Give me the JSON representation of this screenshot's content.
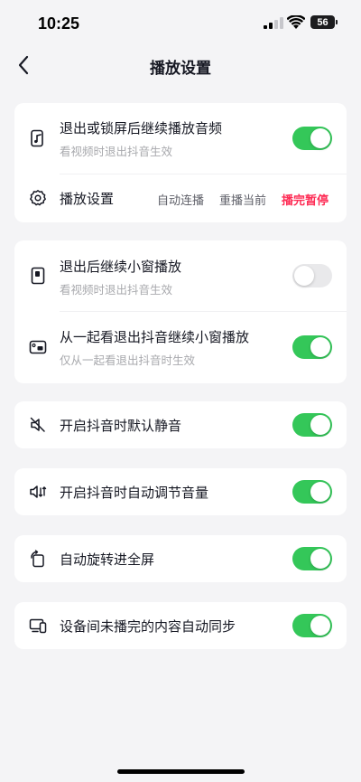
{
  "status": {
    "time": "10:25",
    "battery": "56"
  },
  "header": {
    "title": "播放设置"
  },
  "card1": {
    "background_play": {
      "title": "退出或锁屏后继续播放音频",
      "subtitle": "看视频时退出抖音生效",
      "enabled": true
    },
    "playback": {
      "title": "播放设置",
      "options": [
        "自动连播",
        "重播当前",
        "播完暂停"
      ],
      "selected": "播完暂停"
    }
  },
  "card2": {
    "mini_window": {
      "title": "退出后继续小窗播放",
      "subtitle": "看视频时退出抖音生效",
      "enabled": false
    },
    "watch_together": {
      "title": "从一起看退出抖音继续小窗播放",
      "subtitle": "仅从一起看退出抖音时生效",
      "enabled": true
    }
  },
  "mute": {
    "title": "开启抖音时默认静音",
    "enabled": true
  },
  "volume": {
    "title": "开启抖音时自动调节音量",
    "enabled": true
  },
  "rotate": {
    "title": "自动旋转进全屏",
    "enabled": true
  },
  "sync": {
    "title": "设备间未播完的内容自动同步",
    "enabled": true
  },
  "colors": {
    "accent": "#fe2c55",
    "toggle_on": "#34c759",
    "toggle_off": "#e9e9eb"
  }
}
